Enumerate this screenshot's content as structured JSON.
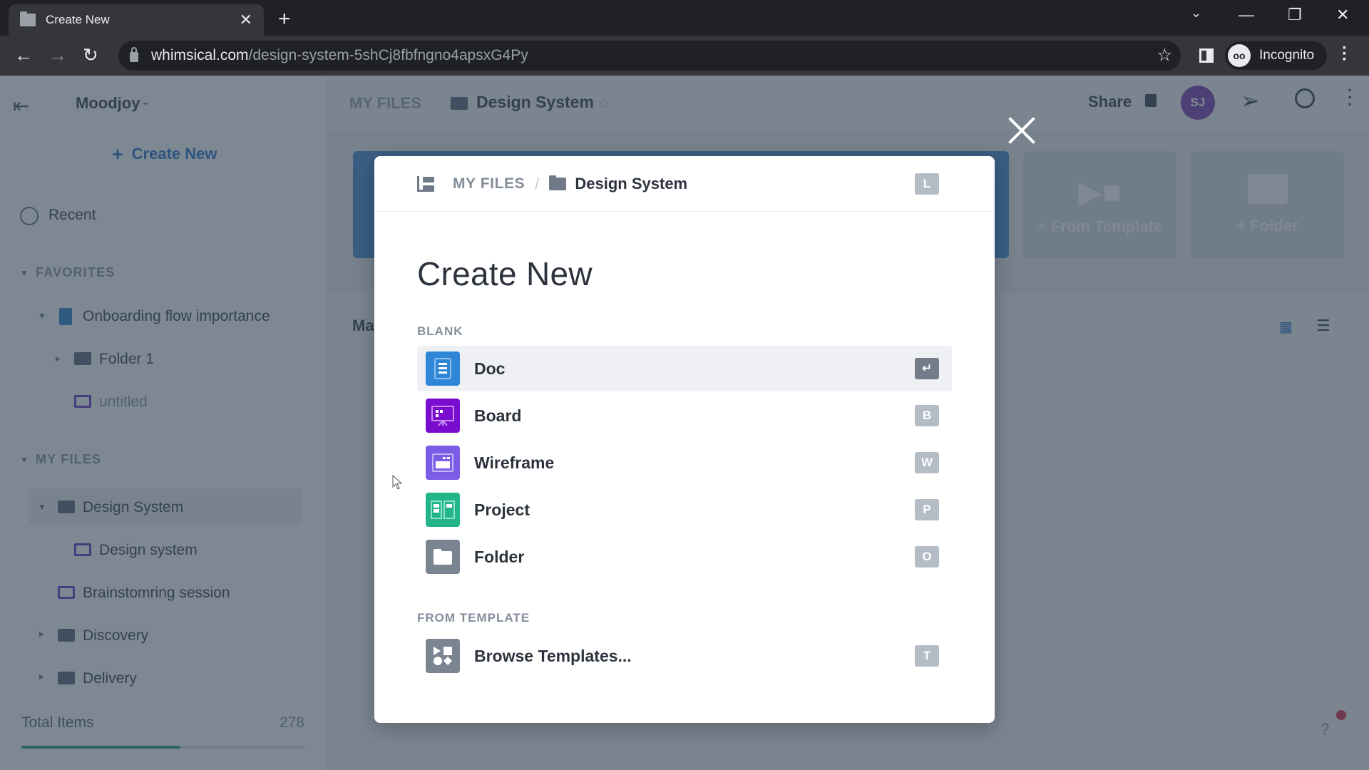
{
  "browser": {
    "tab_title": "Create New",
    "new_tab_symbol": "+",
    "url_host": "whimsical.com",
    "url_path": "/design-system-5shCj8fbfngno4apsxG4Py",
    "profile_label": "Incognito",
    "window_controls": {
      "dropdown": "⌄",
      "minimize": "—",
      "restore": "❐",
      "close": "✕"
    },
    "nav": {
      "back": "←",
      "forward": "→",
      "reload": "↻"
    }
  },
  "sidebar": {
    "workspace": "Moodjoy",
    "create_new": "Create New",
    "recent": "Recent",
    "favorites_header": "FAVORITES",
    "favorites": [
      {
        "label": "Onboarding flow importance",
        "type": "doc",
        "expanded": true
      },
      {
        "label": "Folder 1",
        "type": "folder"
      },
      {
        "label": "untitled",
        "type": "board"
      }
    ],
    "my_files_header": "MY FILES",
    "my_files": [
      {
        "label": "Design System",
        "type": "folder",
        "expanded": true,
        "active": true
      },
      {
        "label": "Design system",
        "type": "board"
      },
      {
        "label": "Brainstomring session",
        "type": "board"
      },
      {
        "label": "Discovery",
        "type": "folder"
      },
      {
        "label": "Delivery",
        "type": "folder"
      }
    ],
    "total_items_label": "Total Items",
    "total_items_value": "278",
    "usage_fraction": 0.56
  },
  "main": {
    "breadcrumb_root": "MY FILES",
    "breadcrumb_current": "Design System",
    "share_label": "Share",
    "avatar_initials": "SJ",
    "tiles": [
      {
        "label": "+ From Template"
      },
      {
        "label": "+ Folder"
      }
    ],
    "partial_label": "Ma",
    "help_symbol": "?"
  },
  "modal": {
    "breadcrumb_root": "MY FILES",
    "breadcrumb_sep": "/",
    "breadcrumb_current": "Design System",
    "breadcrumb_shortcut": "L",
    "title": "Create New",
    "blank_label": "BLANK",
    "blank_options": [
      {
        "label": "Doc",
        "shortcut": "↵",
        "color": "#2f86d6",
        "selected": true
      },
      {
        "label": "Board",
        "shortcut": "B",
        "color": "#7a0ccf"
      },
      {
        "label": "Wireframe",
        "shortcut": "W",
        "color": "#7a5ce6"
      },
      {
        "label": "Project",
        "shortcut": "P",
        "color": "#22b58a"
      },
      {
        "label": "Folder",
        "shortcut": "O",
        "color": "#7b8491"
      }
    ],
    "template_label": "FROM TEMPLATE",
    "template_options": [
      {
        "label": "Browse Templates...",
        "shortcut": "T",
        "color": "#7b8491"
      }
    ]
  }
}
